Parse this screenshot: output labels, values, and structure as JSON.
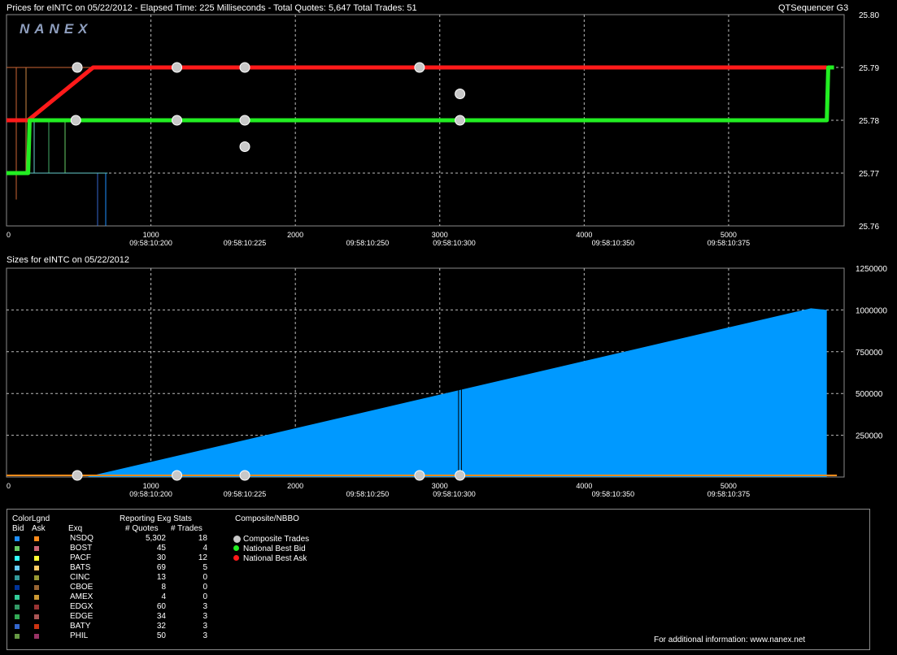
{
  "header": {
    "prices_title": "Prices for  eINTC  on  05/22/2012  -  Elapsed Time: 225 Milliseconds  -  Total Quotes: 5,647  Total Trades: 51",
    "app_name": "QTSequencer G3",
    "sizes_title": "Sizes for  eINTC  on  05/22/2012",
    "watermark": "NANEX"
  },
  "chart_data": [
    {
      "type": "line",
      "title": "Prices for  eINTC  on  05/22/2012",
      "xlim": [
        0,
        5800
      ],
      "ylim": [
        25.76,
        25.8
      ],
      "x_ticks": [
        0,
        1000,
        2000,
        3000,
        4000,
        5000
      ],
      "y_ticks": [
        "25.80",
        "25.79",
        "25.78",
        "25.77",
        "25.76"
      ],
      "y_tick_values": [
        25.8,
        25.79,
        25.78,
        25.77,
        25.76
      ],
      "time_ticks": [
        {
          "x": 1000,
          "label": "09:58:10:200"
        },
        {
          "x": 1650,
          "label": "09:58:10:225"
        },
        {
          "x": 2500,
          "label": "09:58:10:250"
        },
        {
          "x": 3100,
          "label": "09:58:10:300"
        },
        {
          "x": 4200,
          "label": "09:58:10:350"
        },
        {
          "x": 5000,
          "label": "09:58:10:375"
        }
      ],
      "grid": true,
      "series": [
        {
          "name": "National Best Ask",
          "color": "#ff1a1a",
          "points": [
            [
              0,
              25.78
            ],
            [
              150,
              25.78
            ],
            [
              600,
              25.79
            ],
            [
              5680,
              25.79
            ]
          ]
        },
        {
          "name": "National Best Bid",
          "color": "#22ee22",
          "points": [
            [
              0,
              25.77
            ],
            [
              150,
              25.77
            ],
            [
              160,
              25.78
            ],
            [
              5680,
              25.78
            ],
            [
              5690,
              25.79
            ],
            [
              5730,
              25.79
            ]
          ]
        }
      ],
      "trades": [
        [
          490,
          25.79
        ],
        [
          1180,
          25.79
        ],
        [
          1650,
          25.79
        ],
        [
          2860,
          25.79
        ],
        [
          3140,
          25.785
        ],
        [
          480,
          25.78
        ],
        [
          1180,
          25.78
        ],
        [
          1650,
          25.78
        ],
        [
          3140,
          25.78
        ],
        [
          1650,
          25.775
        ]
      ]
    },
    {
      "type": "area",
      "title": "Sizes for  eINTC  on  05/22/2012",
      "xlim": [
        0,
        5800
      ],
      "ylim": [
        0,
        1250000
      ],
      "x_ticks": [
        0,
        1000,
        2000,
        3000,
        4000,
        5000
      ],
      "y_ticks": [
        "1250000",
        "1000000",
        "750000",
        "500000",
        "250000"
      ],
      "y_tick_values": [
        1250000,
        1000000,
        750000,
        500000,
        250000
      ],
      "grid": true,
      "color": "#0099ff",
      "points": [
        [
          550,
          0
        ],
        [
          5570,
          1010000
        ],
        [
          5680,
          1000000
        ],
        [
          5680,
          0
        ]
      ],
      "trades_at_zero": [
        490,
        1180,
        1650,
        2860,
        3140
      ]
    }
  ],
  "legend": {
    "col_color": "ColorLgnd",
    "bid": "Bid",
    "ask": "Ask",
    "exq": "Exq",
    "stats_title": "Reporting Exg Stats",
    "quotes_header": "# Quotes",
    "trades_header": "# Trades",
    "composite_title": "Composite/NBBO",
    "rows": [
      {
        "exq": "NSDQ",
        "quotes": "5,302",
        "trades": "18",
        "bid_color": "#1e90ff",
        "ask_color": "#ff8c1a"
      },
      {
        "exq": "BOST",
        "quotes": "45",
        "trades": "4",
        "bid_color": "#66cc66",
        "ask_color": "#cc6677"
      },
      {
        "exq": "PACF",
        "quotes": "30",
        "trades": "12",
        "bid_color": "#33ffff",
        "ask_color": "#ffff33"
      },
      {
        "exq": "BATS",
        "quotes": "69",
        "trades": "5",
        "bid_color": "#66ccff",
        "ask_color": "#ffcc66"
      },
      {
        "exq": "CINC",
        "quotes": "13",
        "trades": "0",
        "bid_color": "#339999",
        "ask_color": "#999933"
      },
      {
        "exq": "CBOE",
        "quotes": "8",
        "trades": "0",
        "bid_color": "#003399",
        "ask_color": "#996633"
      },
      {
        "exq": "AMEX",
        "quotes": "4",
        "trades": "0",
        "bid_color": "#33cc99",
        "ask_color": "#cc9933"
      },
      {
        "exq": "EDGX",
        "quotes": "60",
        "trades": "3",
        "bid_color": "#339966",
        "ask_color": "#993333"
      },
      {
        "exq": "EDGE",
        "quotes": "34",
        "trades": "3",
        "bid_color": "#33aa55",
        "ask_color": "#aa5555"
      },
      {
        "exq": "BATY",
        "quotes": "32",
        "trades": "3",
        "bid_color": "#3366cc",
        "ask_color": "#cc3311"
      },
      {
        "exq": "PHIL",
        "quotes": "50",
        "trades": "3",
        "bid_color": "#669944",
        "ask_color": "#993366"
      }
    ],
    "composite_items": [
      {
        "label": "Composite Trades",
        "color": "#c8c8c8"
      },
      {
        "label": "National Best Bid",
        "color": "#22ee22"
      },
      {
        "label": "National Best Ask",
        "color": "#ff1a1a"
      }
    ],
    "footer": "For additional information: www.nanex.net"
  }
}
